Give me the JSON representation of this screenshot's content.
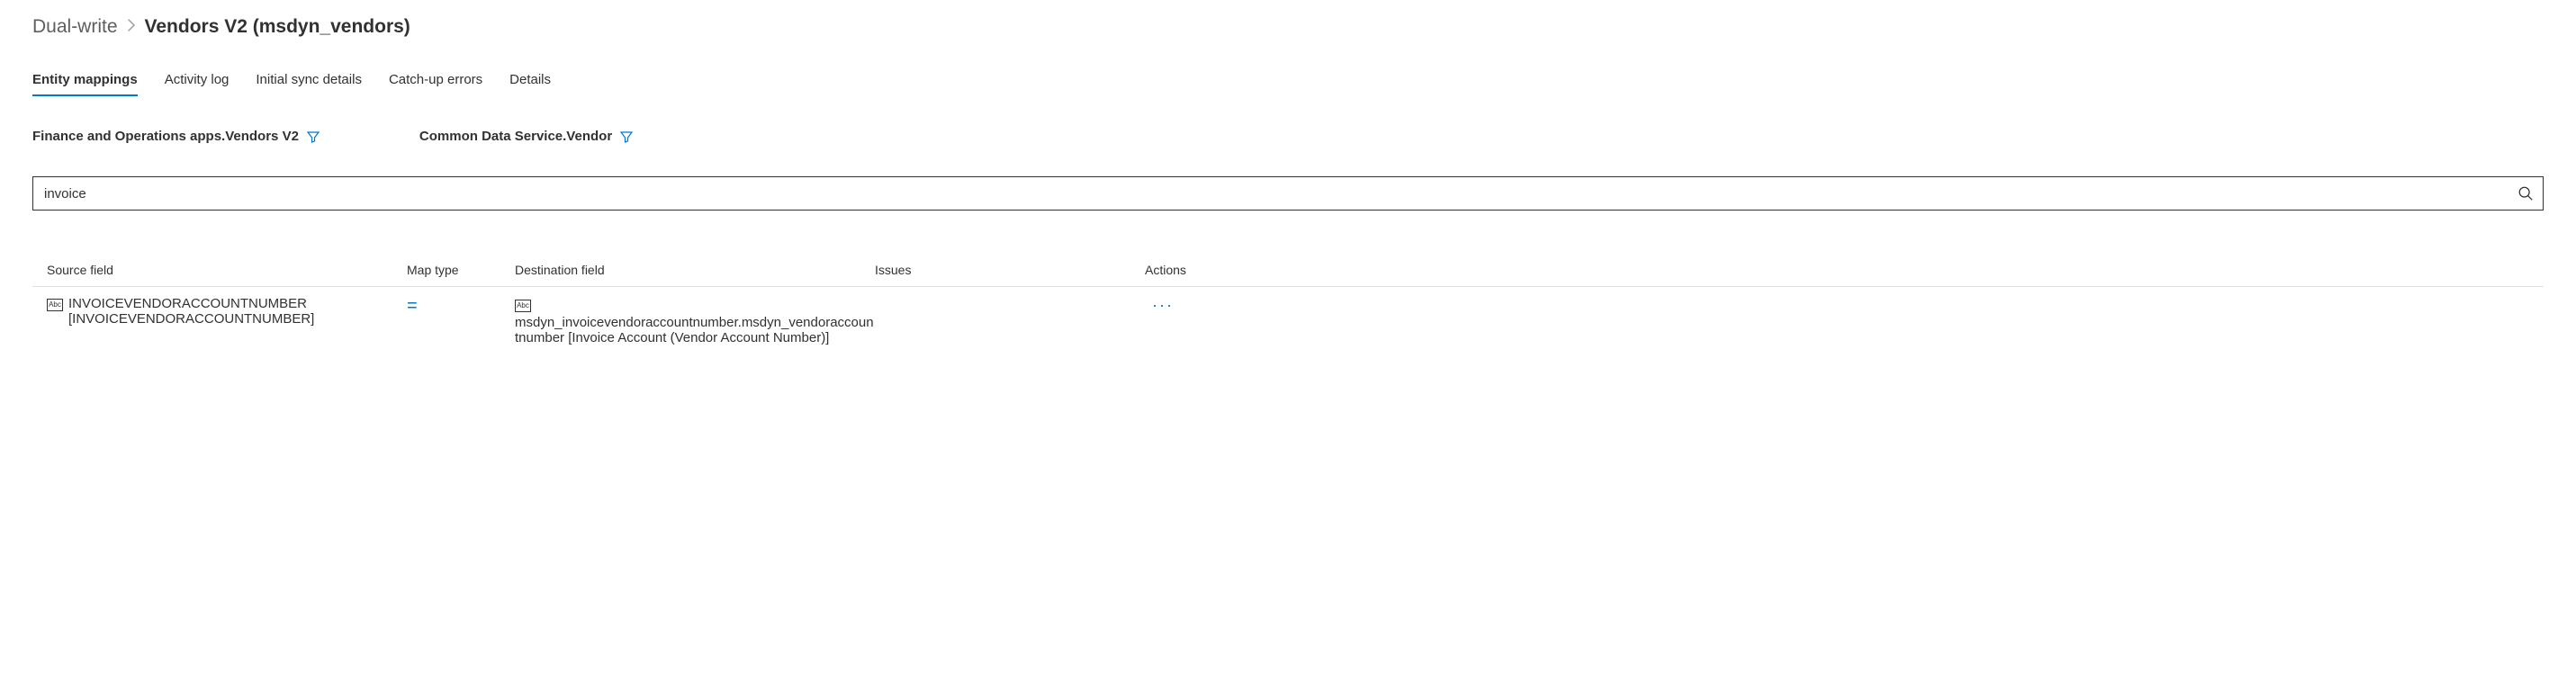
{
  "breadcrumb": {
    "root": "Dual-write",
    "current": "Vendors V2 (msdyn_vendors)"
  },
  "tabs": {
    "entity_mappings": "Entity mappings",
    "activity_log": "Activity log",
    "initial_sync": "Initial sync details",
    "catchup_errors": "Catch-up errors",
    "details": "Details"
  },
  "filters": {
    "left": "Finance and Operations apps.Vendors V2",
    "right": "Common Data Service.Vendor"
  },
  "search": {
    "value": "invoice"
  },
  "columns": {
    "source": "Source field",
    "maptype": "Map type",
    "destination": "Destination field",
    "issues": "Issues",
    "actions": "Actions"
  },
  "rows": [
    {
      "source": "INVOICEVENDORACCOUNTNUMBER [INVOICEVENDORACCOUNTNUMBER]",
      "maptype": "=",
      "destination": "msdyn_invoicevendoraccountnumber.msdyn_vendoraccountnumber [Invoice Account (Vendor Account Number)]",
      "issues": "",
      "actions": "···"
    }
  ],
  "icons": {
    "abc": "Abc"
  }
}
